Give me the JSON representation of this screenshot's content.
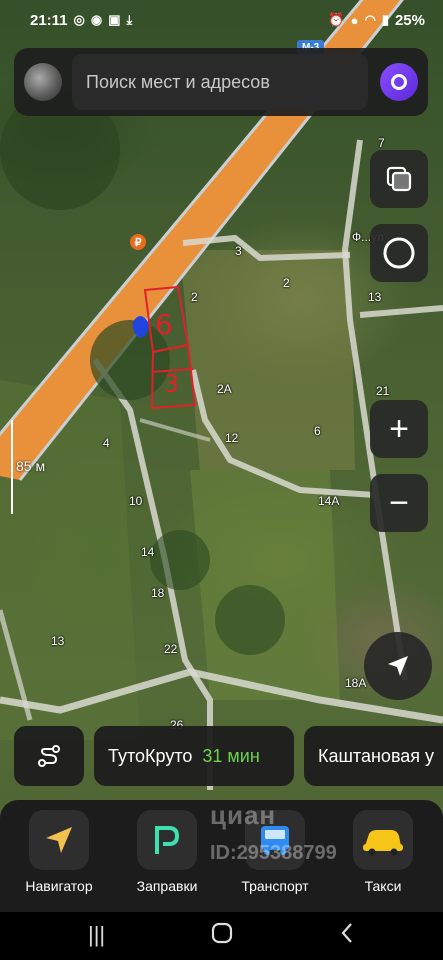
{
  "status_bar": {
    "time": "21:11",
    "battery": "25%"
  },
  "search": {
    "placeholder": "Поиск мест и адресов"
  },
  "map": {
    "road_sign": "М-3",
    "scale": "85 м",
    "plot_labels": [
      "6",
      "3"
    ],
    "street_label": "Ф...ул",
    "house_numbers": [
      "7",
      "3",
      "2",
      "2",
      "13",
      "2А",
      "21",
      "12",
      "6",
      "4",
      "14А",
      "10",
      "14",
      "18",
      "22",
      "13",
      "18А",
      "26"
    ]
  },
  "chips": {
    "chip1": {
      "label": "ТутоКруто",
      "time": "31 мин"
    },
    "chip2": {
      "label": "Каштановая у"
    }
  },
  "apps": [
    {
      "label": "Навигатор"
    },
    {
      "label": "Заправки"
    },
    {
      "label": "Транспорт"
    },
    {
      "label": "Такси"
    }
  ],
  "watermark": {
    "line1": "циан",
    "line2": "ID:295388799"
  },
  "colors": {
    "accent_green": "#6cd34a",
    "alice_purple": "#7a3ff0",
    "highway_orange": "#e8913a",
    "plot_red": "#e0202a"
  }
}
